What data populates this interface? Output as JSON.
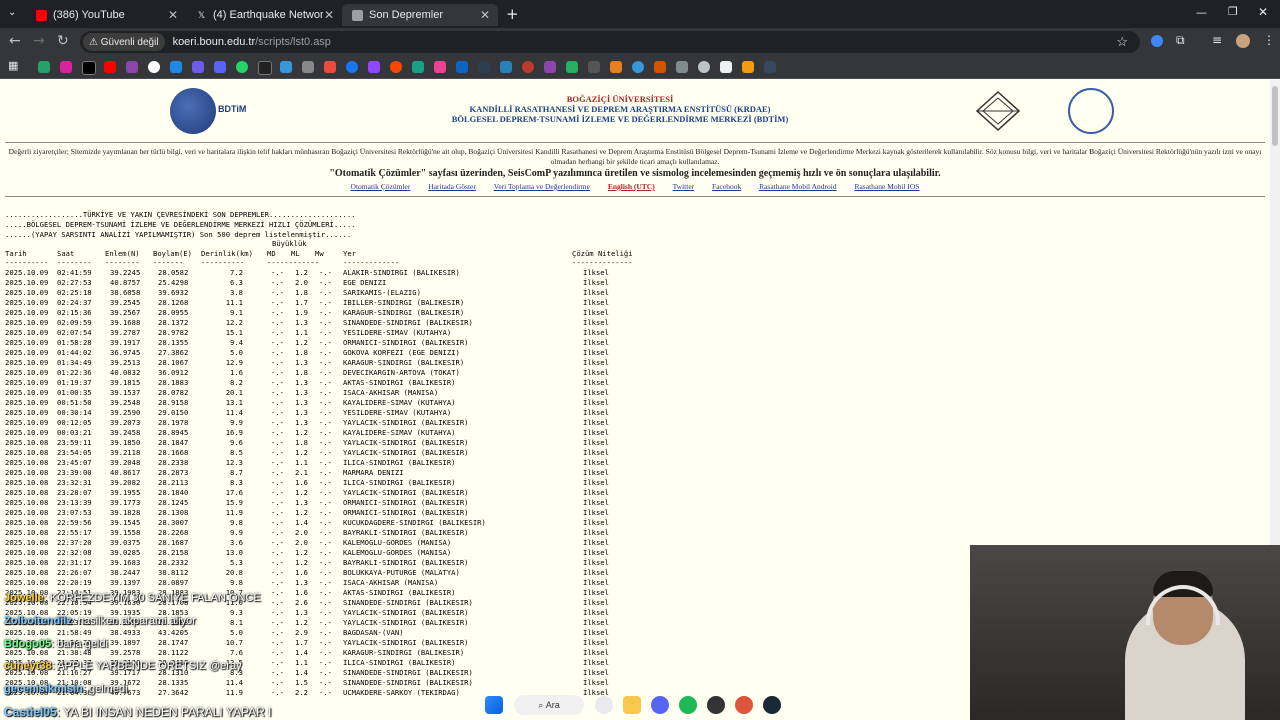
{
  "browser": {
    "tabs": [
      {
        "title": "(386) YouTube",
        "icon": "youtube-icon",
        "active": false
      },
      {
        "title": "(4) Earthquake Network (@Sism",
        "icon": "x-icon",
        "active": false
      },
      {
        "title": "Son Depremler",
        "icon": "page-icon",
        "active": true
      }
    ],
    "new_tab": "+",
    "security_label": "Güvenli değil",
    "url_host": "koeri.boun.edu.tr",
    "url_path": "/scripts/lst0.asp"
  },
  "header": {
    "left_logo_text": "BDTiM",
    "title_line1": "BOĞAZİÇİ ÜNİVERSİTESİ",
    "title_line2": "KANDİLLİ RASATHANESİ VE DEPREM ARAŞTIRMA ENSTİTÜSÜ (KRDAE)",
    "title_line3": "BÖLGESEL DEPREM-TSUNAMİ İZLEME VE DEĞERLENDİRME MERKEZİ (BDTİM)"
  },
  "notice": "Değerli ziyaretçiler; Sitemizde yayımlanan her türlü bilgi, veri ve haritalara ilişkin telif hakları münhasıran Boğaziçi Üniversitesi Rektörlüğü'ne ait olup, Boğaziçi Üniversitesi Kandilli Rasathanesi ve Deprem Araştırma Enstitüsü Bölgesel Deprem-Tsunami İzleme ve Değerlendirme Merkezi kaynak gösterilerek kullanılabilir. Söz konusu bilgi, veri ve haritalar Boğaziçi Üniversitesi Rektörlüğü'nün yazılı izni ve onayı olmadan herhangi bir şekilde ticari amaçlı kullanılamaz.",
  "headline": "\"Otomatik Çözümler\" sayfası üzerinden, SeisComP yazılımınca üretilen ve sismolog incelemesinden geçmemiş hızlı ve ön sonuçlara ulaşılabilir.",
  "links": [
    {
      "label": "Otomatik Çözümler",
      "red": false
    },
    {
      "label": "Haritada Göster",
      "red": false
    },
    {
      "label": "Veri Toplama ve Değerlendirme",
      "red": false
    },
    {
      "label": "English (UTC)",
      "red": true
    },
    {
      "label": "Twitter",
      "red": false
    },
    {
      "label": "Facebook",
      "red": false
    },
    {
      "label": "Rasathane Mobil Android",
      "red": false
    },
    {
      "label": "Rasathane Mobil IOS",
      "red": false
    }
  ],
  "intro": [
    "..................TÜRKİYE VE YAKIN ÇEVRESİNDEKİ SON DEPREMLER....................",
    ".....BÖLGESEL DEPREM-TSUNAMİ İZLEME VE DEĞERLENDİRME MERKEZİ HIZLI ÇÖZÜMLERİ.....",
    "......(YAPAY SARSINTI ANALİZİ YAPILMAMIŞTIR) Son 500 deprem listelenmiştir......"
  ],
  "table": {
    "magnitude_heading": "Büyüklük",
    "columns": [
      "Tarih",
      "Saat",
      "Enlem(N)",
      "Boylam(E)",
      "Derinlik(km)",
      "MD",
      "ML",
      "Mw",
      "Yer",
      "Çözüm Niteliği"
    ],
    "dashes": [
      "----------",
      "--------",
      "--------",
      "-------",
      "----------",
      "------------",
      "-------------",
      "--------------"
    ],
    "rows": [
      [
        "2025.10.09",
        "02:41:59",
        "39.2245",
        "28.0582",
        "7.2",
        "-.-",
        "1.2",
        "-.-",
        "ALAKIR-SINDIRGI (BALIKESIR)",
        "İlksel"
      ],
      [
        "2025.10.09",
        "02:27:53",
        "40.8757",
        "25.4298",
        "6.3",
        "-.-",
        "2.0",
        "-.-",
        "EGE DENIZI",
        "İlksel"
      ],
      [
        "2025.10.09",
        "02:25:18",
        "38.6058",
        "39.6932",
        "3.8",
        "-.-",
        "1.8",
        "-.-",
        "SARIKAMIS-(ELAZIG)",
        "İlksel"
      ],
      [
        "2025.10.09",
        "02:24:37",
        "39.2545",
        "28.1268",
        "11.1",
        "-.-",
        "1.7",
        "-.-",
        "IBILLER-SINDIRGI (BALIKESIR)",
        "İlksel"
      ],
      [
        "2025.10.09",
        "02:15:36",
        "39.2567",
        "28.0955",
        "9.1",
        "-.-",
        "1.9",
        "-.-",
        "KARAGUR-SINDIRGI (BALIKESIR)",
        "İlksel"
      ],
      [
        "2025.10.09",
        "02:09:59",
        "39.1688",
        "28.1372",
        "12.2",
        "-.-",
        "1.3",
        "-.-",
        "SINANDEDE-SINDIRGI (BALIKESIR)",
        "İlksel"
      ],
      [
        "2025.10.09",
        "02:07:54",
        "39.2787",
        "28.9782",
        "15.1",
        "-.-",
        "1.1",
        "-.-",
        "YESILDERE-SIMAV (KUTAHYA)",
        "İlksel"
      ],
      [
        "2025.10.09",
        "01:58:28",
        "39.1917",
        "28.1355",
        "9.4",
        "-.-",
        "1.2",
        "-.-",
        "ORMANICI-SINDIRGI (BALIKESIR)",
        "İlksel"
      ],
      [
        "2025.10.09",
        "01:44:02",
        "36.9745",
        "27.3862",
        "5.0",
        "-.-",
        "1.8",
        "-.-",
        "GOKOVA KORFEZI (EGE DENIZI)",
        "İlksel"
      ],
      [
        "2025.10.09",
        "01:34:49",
        "39.2513",
        "28.1067",
        "12.9",
        "-.-",
        "1.3",
        "-.-",
        "KARAGUR-SINDIRGI (BALIKESIR)",
        "İlksel"
      ],
      [
        "2025.10.09",
        "01:22:36",
        "40.0832",
        "36.0912",
        "1.6",
        "-.-",
        "1.8",
        "-.-",
        "DEVECIKARGIN-ARTOVA (TOKAT)",
        "İlksel"
      ],
      [
        "2025.10.09",
        "01:19:37",
        "39.1815",
        "28.1883",
        "8.2",
        "-.-",
        "1.3",
        "-.-",
        "AKTAS-SINDIRGI (BALIKESIR)",
        "İlksel"
      ],
      [
        "2025.10.09",
        "01:00:35",
        "39.1537",
        "28.0782",
        "20.1",
        "-.-",
        "1.3",
        "-.-",
        "ISACA-AKHISAR (MANISA)",
        "İlksel"
      ],
      [
        "2025.10.09",
        "00:51:50",
        "39.2548",
        "28.9158",
        "13.1",
        "-.-",
        "1.3",
        "-.-",
        "KAYALIDERE-SIMAV (KUTAHYA)",
        "İlksel"
      ],
      [
        "2025.10.09",
        "00:30:14",
        "39.2590",
        "29.0150",
        "11.4",
        "-.-",
        "1.3",
        "-.-",
        "YESILDERE-SIMAV (KUTAHYA)",
        "İlksel"
      ],
      [
        "2025.10.09",
        "00:12:05",
        "39.2073",
        "28.1978",
        "9.9",
        "-.-",
        "1.3",
        "-.-",
        "YAYLACIK-SINDIRGI (BALIKESIR)",
        "İlksel"
      ],
      [
        "2025.10.09",
        "00:03:21",
        "39.2458",
        "28.8945",
        "16.9",
        "-.-",
        "1.2",
        "-.-",
        "KAYALIDERE-SIMAV (KUTAHYA)",
        "İlksel"
      ],
      [
        "2025.10.08",
        "23:59:11",
        "39.1850",
        "28.1847",
        "9.6",
        "-.-",
        "1.8",
        "-.-",
        "YAYLACIK-SINDIRGI (BALIKESIR)",
        "İlksel"
      ],
      [
        "2025.10.08",
        "23:54:05",
        "39.2118",
        "28.1668",
        "8.5",
        "-.-",
        "1.2",
        "-.-",
        "YAYLACIK-SINDIRGI (BALIKESIR)",
        "İlksel"
      ],
      [
        "2025.10.08",
        "23:45:07",
        "39.2048",
        "28.2338",
        "12.3",
        "-.-",
        "1.1",
        "-.-",
        "ILICA-SINDIRGI (BALIKESIR)",
        "İlksel"
      ],
      [
        "2025.10.08",
        "23:39:00",
        "40.8617",
        "28.2873",
        "8.7",
        "-.-",
        "2.1",
        "-.-",
        "MARMARA DENIZI",
        "İlksel"
      ],
      [
        "2025.10.08",
        "23:32:31",
        "39.2082",
        "28.2113",
        "8.3",
        "-.-",
        "1.6",
        "-.-",
        "ILICA-SINDIRGI (BALIKESIR)",
        "İlksel"
      ],
      [
        "2025.10.08",
        "23:28:07",
        "39.1955",
        "28.1840",
        "17.6",
        "-.-",
        "1.2",
        "-.-",
        "YAYLACIK-SINDIRGI (BALIKESIR)",
        "İlksel"
      ],
      [
        "2025.10.08",
        "23:13:39",
        "39.1773",
        "28.1245",
        "15.9",
        "-.-",
        "1.3",
        "-.-",
        "ORMANICI-SINDIRGI (BALIKESIR)",
        "İlksel"
      ],
      [
        "2025.10.08",
        "23:07:53",
        "39.1828",
        "28.1308",
        "11.9",
        "-.-",
        "1.2",
        "-.-",
        "ORMANICI-SINDIRGI (BALIKESIR)",
        "İlksel"
      ],
      [
        "2025.10.08",
        "22:59:56",
        "39.1545",
        "28.3007",
        "9.8",
        "-.-",
        "1.4",
        "-.-",
        "KUCUKDAGDERE-SINDIRGI (BALIKESIR)",
        "İlksel"
      ],
      [
        "2025.10.08",
        "22:55:17",
        "39.1558",
        "28.2268",
        "9.9",
        "-.-",
        "2.0",
        "-.-",
        "BAYRAKLI-SINDIRGI (BALIKESIR)",
        "İlksel"
      ],
      [
        "2025.10.08",
        "22:37:20",
        "39.0375",
        "28.1687",
        "3.6",
        "-.-",
        "2.0",
        "-.-",
        "KALEMOGLU-GORDES (MANISA)",
        "İlksel"
      ],
      [
        "2025.10.08",
        "22:32:08",
        "39.0285",
        "28.2158",
        "13.0",
        "-.-",
        "1.2",
        "-.-",
        "KALEMOGLU-GORDES (MANISA)",
        "İlksel"
      ],
      [
        "2025.10.08",
        "22:31:17",
        "39.1683",
        "28.2332",
        "5.3",
        "-.-",
        "1.2",
        "-.-",
        "BAYRAKLI-SINDIRGI (BALIKESIR)",
        "İlksel"
      ],
      [
        "2025.10.08",
        "22:26:07",
        "38.2447",
        "38.8112",
        "20.8",
        "-.-",
        "1.6",
        "-.-",
        "BOLUKKAYA-PUTURGE (MALATYA)",
        "İlksel"
      ],
      [
        "2025.10.08",
        "22:20:19",
        "39.1397",
        "28.0897",
        "9.8",
        "-.-",
        "1.3",
        "-.-",
        "ISACA-AKHISAR (MANISA)",
        "İlksel"
      ],
      [
        "2025.10.08",
        "22:14:51",
        "39.1983",
        "28.1883",
        "10.7",
        "-.-",
        "1.6",
        "-.-",
        "AKTAS-SINDIRGI (BALIKESIR)",
        "İlksel"
      ],
      [
        "2025.10.08",
        "22:10:54",
        "39.1630",
        "28.1708",
        "11.0",
        "-.-",
        "2.6",
        "-.-",
        "SINANDEDE-SINDIRGI (BALIKESIR)",
        "İlksel"
      ],
      [
        "2025.10.08",
        "22:05:19",
        "39.1935",
        "28.1853",
        "9.3",
        "-.-",
        "1.3",
        "-.-",
        "YAYLACIK-SINDIRGI (BALIKESIR)",
        "İlksel"
      ],
      [
        "2025.10.08",
        "22:03:55",
        "39.2090",
        "28.1583",
        "8.1",
        "-.-",
        "1.2",
        "-.-",
        "YAYLACIK-SINDIRGI (BALIKESIR)",
        "İlksel"
      ],
      [
        "2025.10.08",
        "21:58:49",
        "38.4933",
        "43.4205",
        "5.0",
        "-.-",
        "2.9",
        "-.-",
        "BAGDASAN-(VAN)",
        "İlksel"
      ],
      [
        "2025.10.08",
        "21:54:20",
        "39.1897",
        "28.1747",
        "10.7",
        "-.-",
        "1.7",
        "-.-",
        "YAYLACIK-SINDIRGI (BALIKESIR)",
        "İlksel"
      ],
      [
        "2025.10.08",
        "21:38:48",
        "39.2578",
        "28.1122",
        "7.6",
        "-.-",
        "1.4",
        "-.-",
        "KARAGUR-SINDIRGI (BALIKESIR)",
        "İlksel"
      ],
      [
        "2025.10.08",
        "21:27:37",
        "39.2130",
        "28.2418",
        "12.5",
        "-.-",
        "1.1",
        "-.-",
        "ILICA-SINDIRGI (BALIKESIR)",
        "İlksel"
      ],
      [
        "2025.10.08",
        "21:16:27",
        "39.1717",
        "28.1310",
        "8.3",
        "-.-",
        "1.4",
        "-.-",
        "SINANDEDE-SINDIRGI (BALIKESIR)",
        "İlksel"
      ],
      [
        "2025.10.08",
        "21:10:08",
        "39.1672",
        "28.1335",
        "11.4",
        "-.-",
        "1.5",
        "-.-",
        "SINANDEDE-SINDIRGI (BALIKESIR)",
        "İlksel"
      ],
      [
        "2025.10.08",
        "21:04:36",
        "40.7673",
        "27.3642",
        "11.9",
        "-.-",
        "2.2",
        "-.-",
        "UCMAKDERE-SARKOY (TEKIRDAG)",
        "İlksel"
      ]
    ]
  },
  "overlay_chat": [
    {
      "user": "Jowelle",
      "text": ": KORFEZDEYIM 30 SANIYE FALAN ONCE",
      "cls": "u2"
    },
    {
      "user": "Zolboitendilz",
      "text": ": nasilken akparami aliyor",
      "cls": "u"
    },
    {
      "user": "Bdogo05",
      "text": ": bana geldi",
      "cls": "u3"
    },
    {
      "user": "cuneyt38",
      "text": ": APPLE YARBENDE ORETSIZ @eray",
      "cls": "u2"
    },
    {
      "user": "gecenisikmisin",
      "text": ": gelmedi",
      "cls": "u"
    },
    {
      "user": "Castiel05",
      "text": ": YA BI INSAN NEDEN PARALI YAPAR I",
      "cls": "u"
    }
  ],
  "taskbar": {
    "search_label": "Ara"
  }
}
